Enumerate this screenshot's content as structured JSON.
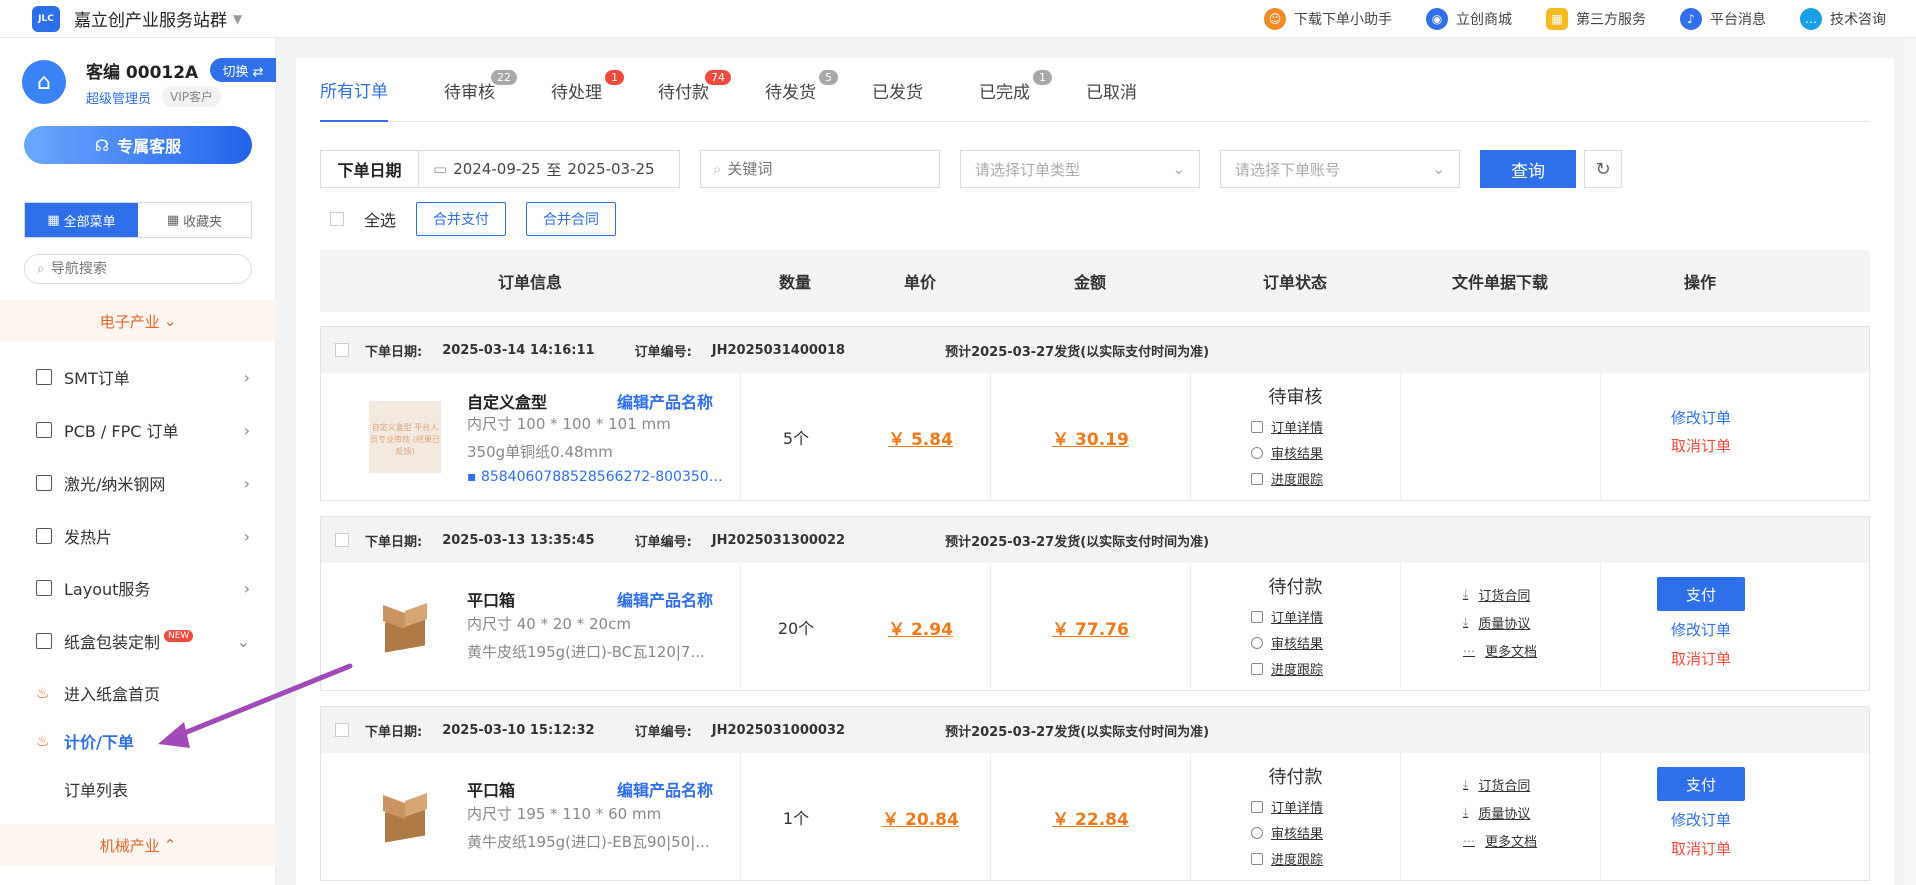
{
  "topbar": {
    "title": "嘉立创产业服务站群",
    "links": [
      {
        "label": "下载下单小助手",
        "icon": "assistant-icon",
        "color": "#f08a24"
      },
      {
        "label": "立创商城",
        "icon": "mall-icon",
        "color": "#2f6fe9"
      },
      {
        "label": "第三方服务",
        "icon": "grid-icon",
        "color": "#f5b921"
      },
      {
        "label": "平台消息",
        "icon": "bell-icon",
        "color": "#2f6fe9"
      },
      {
        "label": "技术咨询",
        "icon": "chat-icon",
        "color": "#1aa0e8"
      }
    ]
  },
  "user": {
    "customer_no": "客编 00012A",
    "switch_label": "切换 ⇄",
    "role": "超级管理员",
    "vip": "VIP客户",
    "cs_label": "专属客服"
  },
  "sidebar": {
    "tab_all": "全部菜单",
    "tab_fav": "收藏夹",
    "search_placeholder": "导航搜索",
    "section_electronics": "电子产业",
    "items": [
      {
        "label": "SMT订单"
      },
      {
        "label": "PCB / FPC 订单"
      },
      {
        "label": "激光/纳米钢网"
      },
      {
        "label": "发热片"
      },
      {
        "label": "Layout服务"
      },
      {
        "label": "纸盒包装定制",
        "badge": "NEW"
      }
    ],
    "sub_items": [
      {
        "label": "进入纸盒首页"
      },
      {
        "label": "计价/下单"
      },
      {
        "label": "订单列表"
      }
    ],
    "section_machinery": "机械产业"
  },
  "tabs": [
    {
      "label": "所有订单",
      "badge": ""
    },
    {
      "label": "待审核",
      "badge": "22"
    },
    {
      "label": "待处理",
      "badge": "1"
    },
    {
      "label": "待付款",
      "badge": "74"
    },
    {
      "label": "待发货",
      "badge": "5"
    },
    {
      "label": "已发货",
      "badge": ""
    },
    {
      "label": "已完成",
      "badge": "1"
    },
    {
      "label": "已取消",
      "badge": ""
    }
  ],
  "filters": {
    "date_label": "下单日期",
    "date_from": "2024-09-25",
    "date_sep": "至",
    "date_to": "2025-03-25",
    "keyword_placeholder": "关键词",
    "order_type_placeholder": "请选择订单类型",
    "account_placeholder": "请选择下单账号",
    "query_label": "查询"
  },
  "bulk": {
    "select_all": "全选",
    "merge_pay": "合并支付",
    "merge_contract": "合并合同"
  },
  "table_headers": [
    "订单信息",
    "数量",
    "单价",
    "金额",
    "订单状态",
    "文件单据下载",
    "操作"
  ],
  "orders": [
    {
      "date_label": "下单日期:",
      "date": "2025-03-14 14:16:11",
      "no_label": "订单编号:",
      "no": "JH2025031400018",
      "ship": "预计2025-03-27发货(以实际支付时间为准)",
      "product": "自定义盒型",
      "edit": "编辑产品名称",
      "size": "内尺寸 100 * 100 * 101 mm",
      "material": "350g单铜纸0.48mm",
      "file": "858406078852856627​2-8003505...",
      "thumb_text": "自定义盒型 平台人员专业审核 (结果已反馈)",
      "qty": "5个",
      "unit_price": "￥ 5.84",
      "amount": "￥ 30.19",
      "status": "待审核",
      "status_links": [
        "订单详情",
        "审核结果",
        "进度跟踪"
      ],
      "docs": [],
      "pay": "",
      "ops": [
        "修改订单",
        "取消订单"
      ]
    },
    {
      "date_label": "下单日期:",
      "date": "2025-03-13 13:35:45",
      "no_label": "订单编号:",
      "no": "JH2025031300022",
      "ship": "预计2025-03-27发货(以实际支付时间为准)",
      "product": "平口箱",
      "edit": "编辑产品名称",
      "size": "内尺寸 40 * 20 * 20cm",
      "material": "黄牛皮纸195g(进口)-BC瓦120|7...",
      "file": "",
      "qty": "20个",
      "unit_price": "￥ 2.94",
      "amount": "￥ 77.76",
      "status": "待付款",
      "status_links": [
        "订单详情",
        "审核结果",
        "进度跟踪"
      ],
      "docs": [
        "订货合同",
        "质量协议",
        "更多文档"
      ],
      "pay": "支付",
      "ops": [
        "修改订单",
        "取消订单"
      ]
    },
    {
      "date_label": "下单日期:",
      "date": "2025-03-10 15:12:32",
      "no_label": "订单编号:",
      "no": "JH2025031000032",
      "ship": "预计2025-03-27发货(以实际支付时间为准)",
      "product": "平口箱",
      "edit": "编辑产品名称",
      "size": "内尺寸 195 * 110 * 60 mm",
      "material": "黄牛皮纸195g(进口)-EB瓦90|50|...",
      "file": "",
      "qty": "1个",
      "unit_price": "￥ 20.84",
      "amount": "￥ 22.84",
      "status": "待付款",
      "status_links": [
        "订单详情",
        "审核结果",
        "进度跟踪"
      ],
      "docs": [
        "订货合同",
        "质量协议",
        "更多文档"
      ],
      "pay": "支付",
      "ops": [
        "修改订单",
        "取消订单"
      ]
    }
  ],
  "colors": {
    "accent": "#2f6fe9",
    "price": "#f07a1a",
    "danger": "#f04a3e",
    "section": "#e0662d",
    "annotation_arrow": "#a24bb8"
  }
}
